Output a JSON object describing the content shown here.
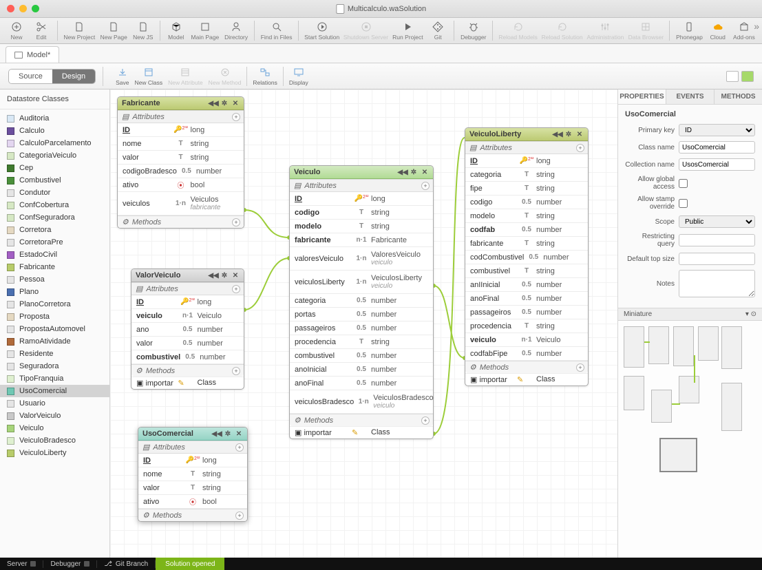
{
  "window": {
    "title": "Multicalculo.waSolution"
  },
  "toolbar": [
    {
      "label": "New",
      "icon": "plus"
    },
    {
      "label": "Edit",
      "icon": "scissors",
      "sep": true
    },
    {
      "label": "New Project",
      "icon": "doc"
    },
    {
      "label": "New Page",
      "icon": "doc"
    },
    {
      "label": "New JS",
      "icon": "doc",
      "sep": true
    },
    {
      "label": "Model",
      "icon": "cube"
    },
    {
      "label": "Main Page",
      "icon": "page"
    },
    {
      "label": "Directory",
      "icon": "user",
      "sep": true
    },
    {
      "label": "Find in Files",
      "icon": "search",
      "sep": true
    },
    {
      "label": "Start Solution",
      "icon": "play"
    },
    {
      "label": "Shutdown Server",
      "icon": "stop",
      "dim": true
    },
    {
      "label": "Run Project",
      "icon": "playf"
    },
    {
      "label": "Git",
      "icon": "git",
      "sep": true
    },
    {
      "label": "Debugger",
      "icon": "bug",
      "sep": true
    },
    {
      "label": "Reload Models",
      "icon": "reload",
      "dim": true
    },
    {
      "label": "Reload Solution",
      "icon": "reload",
      "dim": true
    },
    {
      "label": "Administration",
      "icon": "sliders",
      "dim": true
    },
    {
      "label": "Data Browser",
      "icon": "grid",
      "dim": true,
      "sep": true
    },
    {
      "label": "Phonegap",
      "icon": "phone"
    },
    {
      "label": "Cloud",
      "icon": "cloud",
      "cloud": true
    },
    {
      "label": "Add-ons",
      "icon": "box"
    }
  ],
  "tab": {
    "label": "Model*"
  },
  "segments": {
    "source": "Source",
    "design": "Design"
  },
  "subtoolbar": [
    {
      "label": "Save",
      "icon": "save"
    },
    {
      "label": "New Class",
      "icon": "class"
    },
    {
      "label": "New Attribute",
      "icon": "attr",
      "dim": true
    },
    {
      "label": "New Method",
      "icon": "method",
      "dim": true,
      "sep": true
    },
    {
      "label": "Relations",
      "icon": "rel",
      "sep": true
    },
    {
      "label": "Display",
      "icon": "disp"
    }
  ],
  "sidebar": {
    "header": "Datastore Classes",
    "items": [
      {
        "label": "Auditoria",
        "color": "#d9e8f5"
      },
      {
        "label": "Calculo",
        "color": "#6b4f9e"
      },
      {
        "label": "CalculoParcelamento",
        "color": "#e3d6f0"
      },
      {
        "label": "CategoriaVeiculo",
        "color": "#d6e8c4"
      },
      {
        "label": "Cep",
        "color": "#3f7a2e"
      },
      {
        "label": "Combustivel",
        "color": "#4a8f3a"
      },
      {
        "label": "Condutor",
        "color": "#e5e5e5"
      },
      {
        "label": "ConfCobertura",
        "color": "#d6e8c4"
      },
      {
        "label": "ConfSeguradora",
        "color": "#d6e8c4"
      },
      {
        "label": "Corretora",
        "color": "#e5d9c2"
      },
      {
        "label": "CorretoraPre",
        "color": "#e5e5e5"
      },
      {
        "label": "EstadoCivil",
        "color": "#a35fc4"
      },
      {
        "label": "Fabricante",
        "color": "#b8cc6a"
      },
      {
        "label": "Pessoa",
        "color": "#e5e5e5"
      },
      {
        "label": "Plano",
        "color": "#4a6fb0"
      },
      {
        "label": "PlanoCorretora",
        "color": "#e5e5e5"
      },
      {
        "label": "Proposta",
        "color": "#e5d9c2"
      },
      {
        "label": "PropostaAutomovel",
        "color": "#e5e5e5"
      },
      {
        "label": "RamoAtividade",
        "color": "#b06a3a"
      },
      {
        "label": "Residente",
        "color": "#e5e5e5"
      },
      {
        "label": "Seguradora",
        "color": "#e5e5e5"
      },
      {
        "label": "TipoFranquia",
        "color": "#dff0d0"
      },
      {
        "label": "UsoComercial",
        "color": "#6fc7b3",
        "sel": true
      },
      {
        "label": "Usuario",
        "color": "#e5e5e5"
      },
      {
        "label": "ValorVeiculo",
        "color": "#c9c9c9"
      },
      {
        "label": "Veiculo",
        "color": "#a7d47a"
      },
      {
        "label": "VeiculoBradesco",
        "color": "#dff0d0"
      },
      {
        "label": "VeiculoLiberty",
        "color": "#b8cc6a"
      }
    ]
  },
  "labels": {
    "attributes": "Attributes",
    "methods": "Methods",
    "importar": "importar",
    "class": "Class"
  },
  "entities": {
    "fabricante": {
      "title": "Fabricante",
      "rows": [
        {
          "name": "ID",
          "icon": "key",
          "type": "long",
          "bold": true,
          "u": true
        },
        {
          "name": "nome",
          "icon": "T",
          "type": "string"
        },
        {
          "name": "valor",
          "icon": "T",
          "type": "string"
        },
        {
          "name": "codigoBradesco",
          "icon": "05",
          "type": "number"
        },
        {
          "name": "ativo",
          "icon": "bool",
          "type": "bool"
        },
        {
          "name": "veiculos",
          "icon": "1n",
          "type": "Veiculos",
          "sub": "fabricante",
          "tall": true
        }
      ]
    },
    "valorveiculo": {
      "title": "ValorVeiculo",
      "rows": [
        {
          "name": "ID",
          "icon": "key",
          "type": "long",
          "bold": true,
          "u": true
        },
        {
          "name": "veiculo",
          "icon": "n1",
          "type": "Veiculo",
          "bold": true
        },
        {
          "name": "ano",
          "icon": "05",
          "type": "number"
        },
        {
          "name": "valor",
          "icon": "05",
          "type": "number"
        },
        {
          "name": "combustivel",
          "icon": "05",
          "type": "number",
          "bold": true
        }
      ],
      "method": true
    },
    "usocomercial": {
      "title": "UsoComercial",
      "rows": [
        {
          "name": "ID",
          "icon": "key",
          "type": "long",
          "bold": true,
          "u": true
        },
        {
          "name": "nome",
          "icon": "T",
          "type": "string"
        },
        {
          "name": "valor",
          "icon": "T",
          "type": "string"
        },
        {
          "name": "ativo",
          "icon": "bool",
          "type": "bool"
        }
      ]
    },
    "veiculo": {
      "title": "Veiculo",
      "rows": [
        {
          "name": "ID",
          "icon": "key",
          "type": "long",
          "bold": true,
          "u": true
        },
        {
          "name": "codigo",
          "icon": "T",
          "type": "string",
          "bold": true
        },
        {
          "name": "modelo",
          "icon": "T",
          "type": "string",
          "bold": true
        },
        {
          "name": "fabricante",
          "icon": "n1",
          "type": "Fabricante",
          "bold": true
        },
        {
          "name": "valoresVeiculo",
          "icon": "1n",
          "type": "ValoresVeiculo",
          "sub": "veiculo",
          "tall": true
        },
        {
          "name": "veiculosLiberty",
          "icon": "1n",
          "type": "VeiculosLiberty",
          "sub": "veiculo",
          "tall": true
        },
        {
          "name": "categoria",
          "icon": "05",
          "type": "number"
        },
        {
          "name": "portas",
          "icon": "05",
          "type": "number"
        },
        {
          "name": "passageiros",
          "icon": "05",
          "type": "number"
        },
        {
          "name": "procedencia",
          "icon": "T",
          "type": "string"
        },
        {
          "name": "combustivel",
          "icon": "05",
          "type": "number"
        },
        {
          "name": "anoInicial",
          "icon": "05",
          "type": "number"
        },
        {
          "name": "anoFinal",
          "icon": "05",
          "type": "number"
        },
        {
          "name": "veiculosBradesco",
          "icon": "1n",
          "type": "VeiculosBradesco",
          "sub": "veiculo",
          "tall": true
        }
      ],
      "method": true
    },
    "veiculoliberty": {
      "title": "VeiculoLiberty",
      "rows": [
        {
          "name": "ID",
          "icon": "key",
          "type": "long",
          "bold": true,
          "u": true
        },
        {
          "name": "categoria",
          "icon": "T",
          "type": "string"
        },
        {
          "name": "fipe",
          "icon": "T",
          "type": "string"
        },
        {
          "name": "codigo",
          "icon": "05",
          "type": "number"
        },
        {
          "name": "modelo",
          "icon": "T",
          "type": "string"
        },
        {
          "name": "codfab",
          "icon": "05",
          "type": "number",
          "bold": true
        },
        {
          "name": "fabricante",
          "icon": "T",
          "type": "string"
        },
        {
          "name": "codCombustivel",
          "icon": "05",
          "type": "number"
        },
        {
          "name": "combustivel",
          "icon": "T",
          "type": "string"
        },
        {
          "name": "anIInicial",
          "icon": "05",
          "type": "number"
        },
        {
          "name": "anoFinal",
          "icon": "05",
          "type": "number"
        },
        {
          "name": "passageiros",
          "icon": "05",
          "type": "number"
        },
        {
          "name": "procedencia",
          "icon": "T",
          "type": "string"
        },
        {
          "name": "veiculo",
          "icon": "n1",
          "type": "Veiculo",
          "bold": true
        },
        {
          "name": "codfabFipe",
          "icon": "05",
          "type": "number"
        }
      ],
      "method": true
    }
  },
  "properties": {
    "tabs": [
      "PROPERTIES",
      "EVENTS",
      "METHODS"
    ],
    "heading": "UsoComercial",
    "fields": {
      "primaryKeyLabel": "Primary key",
      "primaryKey": "ID",
      "classNameLabel": "Class name",
      "className": "UsoComercial",
      "collectionNameLabel": "Collection name",
      "collectionName": "UsosComercial",
      "allowGlobalLabel": "Allow global access",
      "allowStampLabel": "Allow stamp override",
      "scopeLabel": "Scope",
      "scope": "Public",
      "restrictLabel": "Restricting query",
      "topSizeLabel": "Default top size",
      "notesLabel": "Notes"
    },
    "miniature": "Miniature"
  },
  "status": {
    "server": "Server",
    "debugger": "Debugger",
    "git": "Git Branch",
    "msg": "Solution opened"
  }
}
